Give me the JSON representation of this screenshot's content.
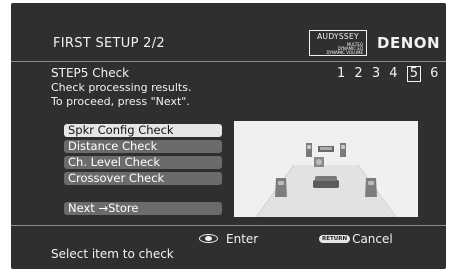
{
  "header": {
    "title": "FIRST SETUP 2/2",
    "audyssey": {
      "brand": "AUDYSSEY",
      "line1": "MULTEQ",
      "line2": "DYNAMIC EQ",
      "line3": "DYNAMIC VOLUME"
    },
    "brand": "DENON"
  },
  "step": {
    "title": "STEP5 Check",
    "desc_line1": "Check processing results.",
    "desc_line2": "To proceed, press \"Next\".",
    "indicators": [
      "1",
      "2",
      "3",
      "4",
      "5",
      "6"
    ],
    "active": "5"
  },
  "menu": {
    "items": [
      {
        "label": "Spkr Config Check",
        "selected": true
      },
      {
        "label": "Distance Check",
        "selected": false
      },
      {
        "label": "Ch. Level Check",
        "selected": false
      },
      {
        "label": "Crossover Check",
        "selected": false
      }
    ],
    "next_label": "Next →Store"
  },
  "footer": {
    "enter_label": "Enter",
    "return_icon_text": "RETURN",
    "cancel_label": "Cancel",
    "status": "Select item to check"
  },
  "icons": {
    "enter": "enter-button-icon",
    "return": "return-button-icon"
  }
}
